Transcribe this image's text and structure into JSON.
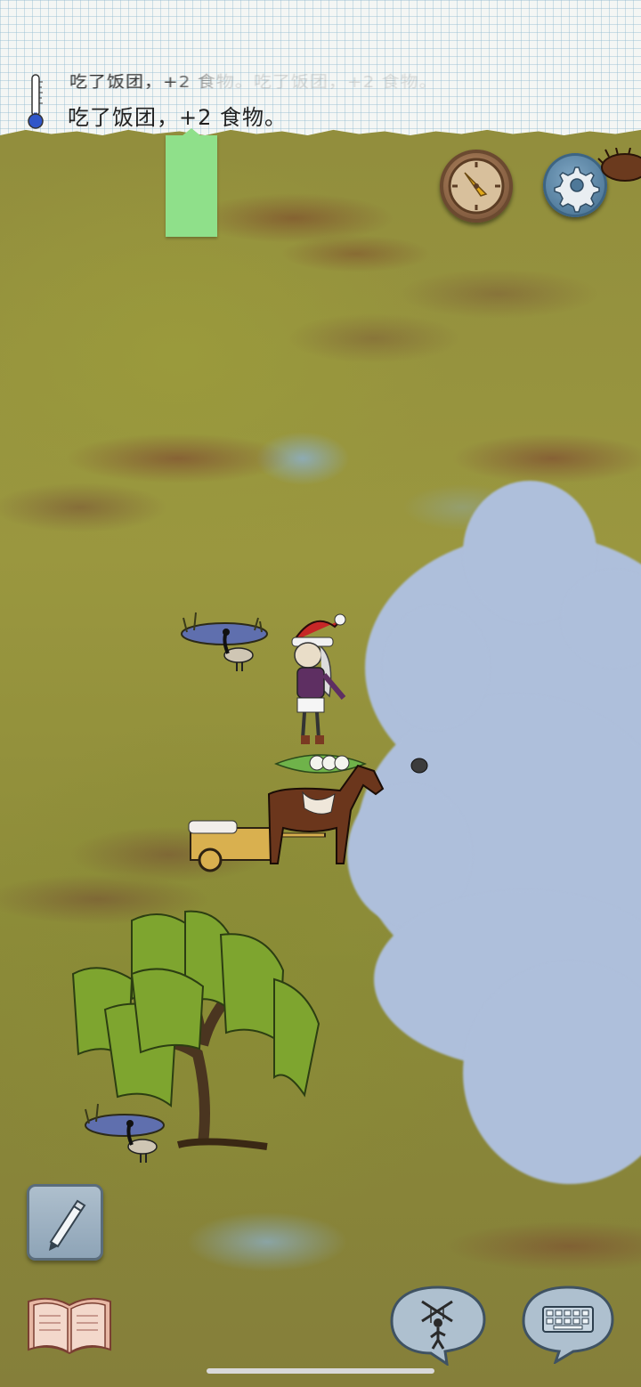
{
  "header": {
    "faded_previous_message": "吃了饭团，+2 食物。吃了饭团，+2 食物。",
    "message": "吃了饭团，+2 食物。"
  },
  "icons": {
    "thermometer": "thermometer-icon",
    "compass": "compass-icon",
    "settings": "gear-icon",
    "pencil": "pencil-icon",
    "journal": "open-book-icon",
    "puppet": "puppet-icon",
    "keyboard": "keyboard-icon"
  },
  "colors": {
    "grass": "#8f8b3c",
    "fog": "#aebfdb",
    "sticky_tab": "#8fe08a",
    "compass_wood": "#7d573c",
    "settings_blue": "#4e7898",
    "thermometer_mercury": "#2f56c9"
  },
  "thermometer": {
    "level": 0.12
  }
}
